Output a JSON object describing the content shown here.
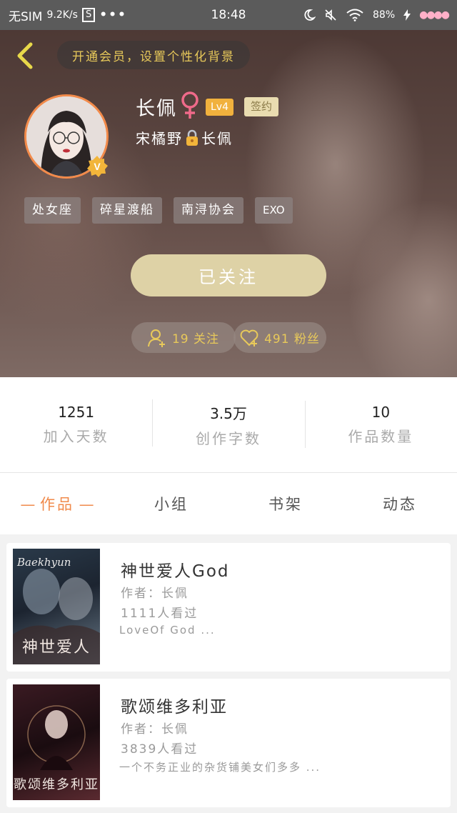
{
  "status_bar": {
    "carrier": "无SIM",
    "speed": "9.2K/s",
    "box_icon_label": "S",
    "dots": "•••",
    "time": "18:48",
    "battery": "88%"
  },
  "header": {
    "vip_banner": "开通会员，设置个性化背景",
    "username": "长佩",
    "gender_icon": "female-icon",
    "level": "Lv4",
    "sign_badge": "签约",
    "couple_left": "宋橘野",
    "couple_right": "长佩",
    "verified_label": "V",
    "tags": [
      "处女座",
      "碎星渡船",
      "南浔协会",
      "EXO"
    ],
    "follow_button": "已关注",
    "following_count": "19 关注",
    "fans_count": "491 粉丝"
  },
  "stats": [
    {
      "value": "1251",
      "label": "加入天数"
    },
    {
      "value": "3.5万",
      "label": "创作字数"
    },
    {
      "value": "10",
      "label": "作品数量"
    }
  ],
  "tabs": [
    {
      "label": "作品",
      "active": true
    },
    {
      "label": "小组",
      "active": false
    },
    {
      "label": "书架",
      "active": false
    },
    {
      "label": "动态",
      "active": false
    }
  ],
  "works": [
    {
      "title": "神世爱人God",
      "author": "作者：长佩",
      "views": "1111人看过",
      "desc": "LoveOf God  ...",
      "cover_top_text": "Baekhyun",
      "cover_title": "神世爱人"
    },
    {
      "title": "歌颂维多利亚",
      "author": "作者：长佩",
      "views": "3839人看过",
      "desc": "一个不务正业的杂货铺美女们多多 ...",
      "cover_top_text": "",
      "cover_title": "歌颂维多利亚"
    }
  ],
  "colors": {
    "accent": "#f08a4b",
    "gold": "#e8c95a",
    "follow_button": "#ded2a6"
  }
}
